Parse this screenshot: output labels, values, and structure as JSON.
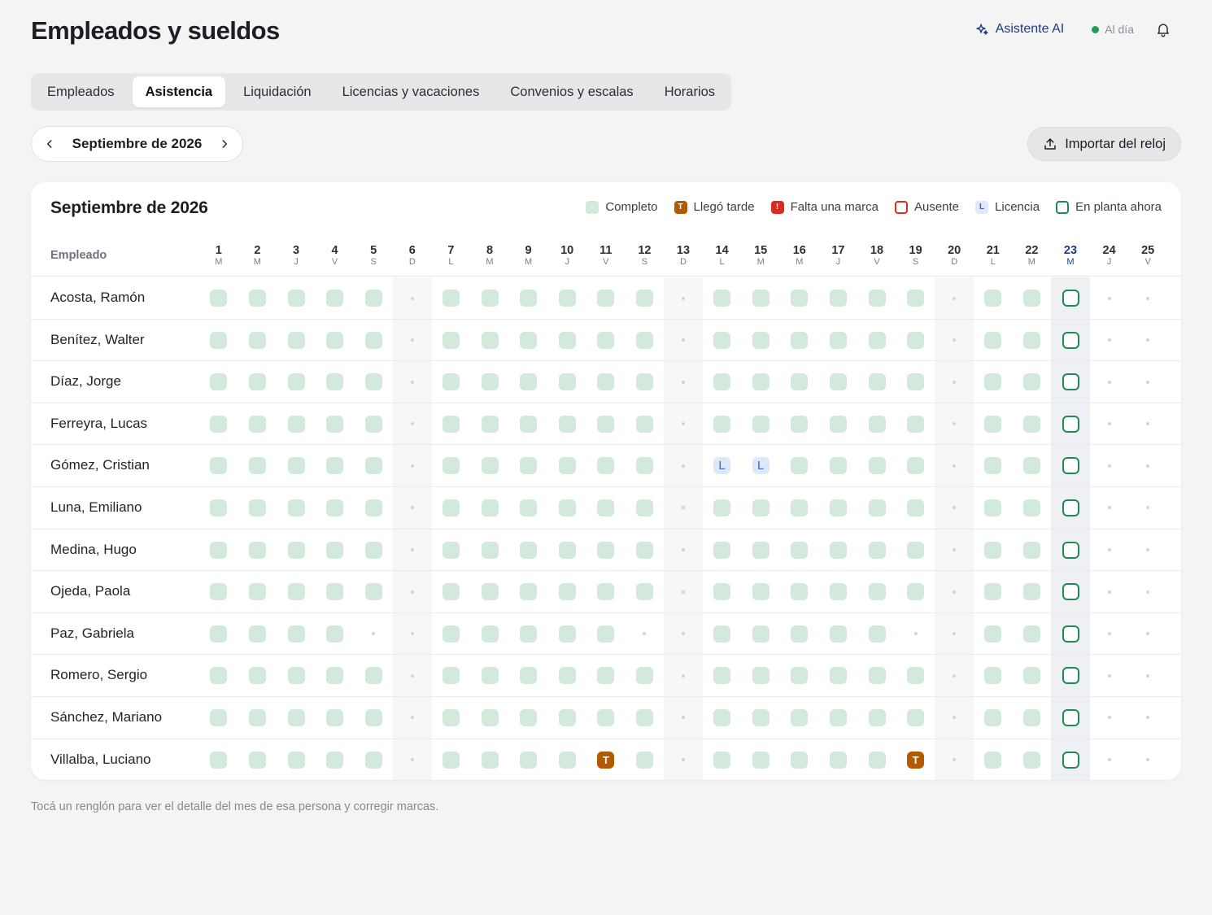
{
  "header": {
    "title": "Empleados y sueldos",
    "ai_label": "Asistente AI",
    "status_label": "Al día"
  },
  "tabs": [
    {
      "label": "Empleados",
      "active": false
    },
    {
      "label": "Asistencia",
      "active": true
    },
    {
      "label": "Liquidación",
      "active": false
    },
    {
      "label": "Licencias y vacaciones",
      "active": false
    },
    {
      "label": "Convenios y escalas",
      "active": false
    },
    {
      "label": "Horarios",
      "active": false
    }
  ],
  "month_nav": {
    "label": "Septiembre de 2026"
  },
  "import_button": {
    "label": "Importar del reloj"
  },
  "card": {
    "title": "Septiembre de 2026",
    "employee_header": "Empleado"
  },
  "legend": [
    {
      "key": "complete",
      "label": "Completo",
      "mark": ""
    },
    {
      "key": "late",
      "label": "Llegó tarde",
      "mark": "T"
    },
    {
      "key": "missing",
      "label": "Falta una marca",
      "mark": "!"
    },
    {
      "key": "absent",
      "label": "Ausente",
      "mark": ""
    },
    {
      "key": "leave",
      "label": "Licencia",
      "mark": "L"
    },
    {
      "key": "now",
      "label": "En planta ahora",
      "mark": ""
    }
  ],
  "days": [
    {
      "num": "1",
      "wd": "M"
    },
    {
      "num": "2",
      "wd": "M"
    },
    {
      "num": "3",
      "wd": "J"
    },
    {
      "num": "4",
      "wd": "V"
    },
    {
      "num": "5",
      "wd": "S"
    },
    {
      "num": "6",
      "wd": "D"
    },
    {
      "num": "7",
      "wd": "L"
    },
    {
      "num": "8",
      "wd": "M"
    },
    {
      "num": "9",
      "wd": "M"
    },
    {
      "num": "10",
      "wd": "J"
    },
    {
      "num": "11",
      "wd": "V"
    },
    {
      "num": "12",
      "wd": "S"
    },
    {
      "num": "13",
      "wd": "D"
    },
    {
      "num": "14",
      "wd": "L"
    },
    {
      "num": "15",
      "wd": "M"
    },
    {
      "num": "16",
      "wd": "M"
    },
    {
      "num": "17",
      "wd": "J"
    },
    {
      "num": "18",
      "wd": "V"
    },
    {
      "num": "19",
      "wd": "S"
    },
    {
      "num": "20",
      "wd": "D"
    },
    {
      "num": "21",
      "wd": "L"
    },
    {
      "num": "22",
      "wd": "M"
    },
    {
      "num": "23",
      "wd": "M"
    },
    {
      "num": "24",
      "wd": "J"
    },
    {
      "num": "25",
      "wd": "V"
    }
  ],
  "today_index": 22,
  "weekend_indices": [
    5,
    12,
    19
  ],
  "status_codes": {
    "c": "complete",
    "t": "late",
    "l": "leave",
    "n": "now",
    "d": "no-data"
  },
  "employees": [
    {
      "name": "Acosta, Ramón",
      "days": [
        "c",
        "c",
        "c",
        "c",
        "c",
        "d",
        "c",
        "c",
        "c",
        "c",
        "c",
        "c",
        "d",
        "c",
        "c",
        "c",
        "c",
        "c",
        "c",
        "d",
        "c",
        "c",
        "n",
        "d",
        "d"
      ]
    },
    {
      "name": "Benítez, Walter",
      "days": [
        "c",
        "c",
        "c",
        "c",
        "c",
        "d",
        "c",
        "c",
        "c",
        "c",
        "c",
        "c",
        "d",
        "c",
        "c",
        "c",
        "c",
        "c",
        "c",
        "d",
        "c",
        "c",
        "n",
        "d",
        "d"
      ]
    },
    {
      "name": "Díaz, Jorge",
      "days": [
        "c",
        "c",
        "c",
        "c",
        "c",
        "d",
        "c",
        "c",
        "c",
        "c",
        "c",
        "c",
        "d",
        "c",
        "c",
        "c",
        "c",
        "c",
        "c",
        "d",
        "c",
        "c",
        "n",
        "d",
        "d"
      ]
    },
    {
      "name": "Ferreyra, Lucas",
      "days": [
        "c",
        "c",
        "c",
        "c",
        "c",
        "d",
        "c",
        "c",
        "c",
        "c",
        "c",
        "c",
        "d",
        "c",
        "c",
        "c",
        "c",
        "c",
        "c",
        "d",
        "c",
        "c",
        "n",
        "d",
        "d"
      ]
    },
    {
      "name": "Gómez, Cristian",
      "days": [
        "c",
        "c",
        "c",
        "c",
        "c",
        "d",
        "c",
        "c",
        "c",
        "c",
        "c",
        "c",
        "d",
        "l",
        "l",
        "c",
        "c",
        "c",
        "c",
        "d",
        "c",
        "c",
        "n",
        "d",
        "d"
      ]
    },
    {
      "name": "Luna, Emiliano",
      "days": [
        "c",
        "c",
        "c",
        "c",
        "c",
        "d",
        "c",
        "c",
        "c",
        "c",
        "c",
        "c",
        "d",
        "c",
        "c",
        "c",
        "c",
        "c",
        "c",
        "d",
        "c",
        "c",
        "n",
        "d",
        "d"
      ]
    },
    {
      "name": "Medina, Hugo",
      "days": [
        "c",
        "c",
        "c",
        "c",
        "c",
        "d",
        "c",
        "c",
        "c",
        "c",
        "c",
        "c",
        "d",
        "c",
        "c",
        "c",
        "c",
        "c",
        "c",
        "d",
        "c",
        "c",
        "n",
        "d",
        "d"
      ]
    },
    {
      "name": "Ojeda, Paola",
      "days": [
        "c",
        "c",
        "c",
        "c",
        "c",
        "d",
        "c",
        "c",
        "c",
        "c",
        "c",
        "c",
        "d",
        "c",
        "c",
        "c",
        "c",
        "c",
        "c",
        "d",
        "c",
        "c",
        "n",
        "d",
        "d"
      ]
    },
    {
      "name": "Paz, Gabriela",
      "days": [
        "c",
        "c",
        "c",
        "c",
        "d",
        "d",
        "c",
        "c",
        "c",
        "c",
        "c",
        "d",
        "d",
        "c",
        "c",
        "c",
        "c",
        "c",
        "d",
        "d",
        "c",
        "c",
        "n",
        "d",
        "d"
      ]
    },
    {
      "name": "Romero, Sergio",
      "days": [
        "c",
        "c",
        "c",
        "c",
        "c",
        "d",
        "c",
        "c",
        "c",
        "c",
        "c",
        "c",
        "d",
        "c",
        "c",
        "c",
        "c",
        "c",
        "c",
        "d",
        "c",
        "c",
        "n",
        "d",
        "d"
      ]
    },
    {
      "name": "Sánchez, Mariano",
      "days": [
        "c",
        "c",
        "c",
        "c",
        "c",
        "d",
        "c",
        "c",
        "c",
        "c",
        "c",
        "c",
        "d",
        "c",
        "c",
        "c",
        "c",
        "c",
        "c",
        "d",
        "c",
        "c",
        "n",
        "d",
        "d"
      ]
    },
    {
      "name": "Villalba, Luciano",
      "days": [
        "c",
        "c",
        "c",
        "c",
        "c",
        "d",
        "c",
        "c",
        "c",
        "c",
        "t",
        "c",
        "d",
        "c",
        "c",
        "c",
        "c",
        "c",
        "t",
        "d",
        "c",
        "c",
        "n",
        "d",
        "d"
      ]
    }
  ],
  "cell_marks": {
    "t": "T",
    "l": "L"
  },
  "footer_note": "Tocá un renglón para ver el detalle del mes de esa persona y corregir marcas."
}
